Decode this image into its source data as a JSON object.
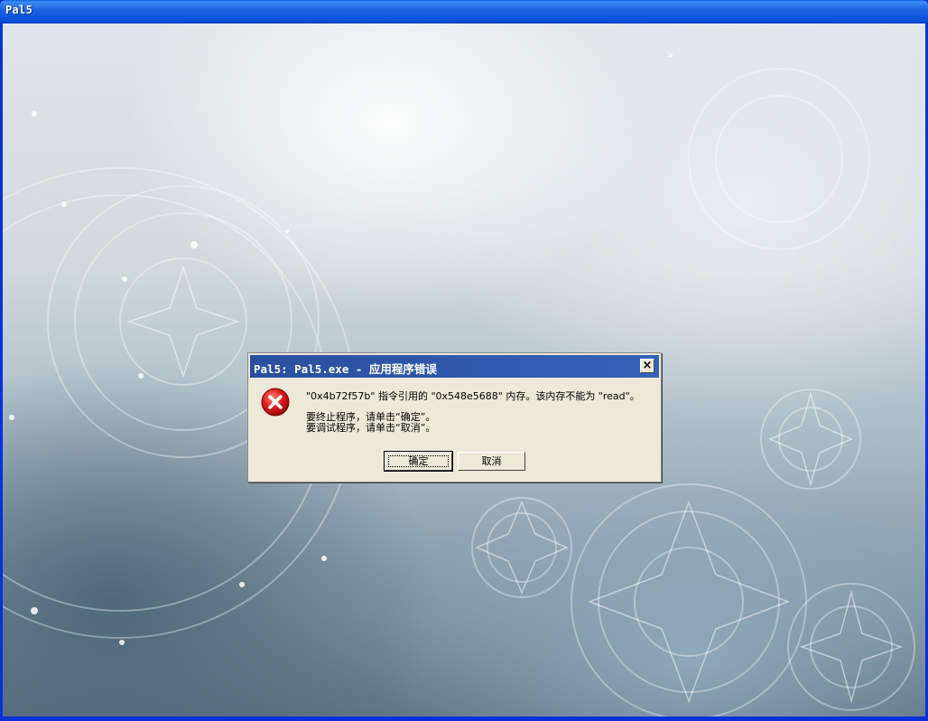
{
  "window": {
    "title": "Pal5"
  },
  "dialog": {
    "title": "Pal5: Pal5.exe - 应用程序错误",
    "close_label": "×",
    "icon": "error-icon",
    "message_line1": "\"0x4b72f57b\" 指令引用的 \"0x548e5688\" 内存。该内存不能为 \"read\"。",
    "message_line2": "要终止程序，请单击“确定”。",
    "message_line3": "要调试程序，请单击“取消”。",
    "ok_label": "确定",
    "cancel_label": "取消"
  },
  "colors": {
    "titlebar": "#0a4fd9",
    "dialog_titlebar": "#2a4f9e",
    "dialog_bg": "#ece9d8",
    "error_red": "#e01b1b"
  }
}
